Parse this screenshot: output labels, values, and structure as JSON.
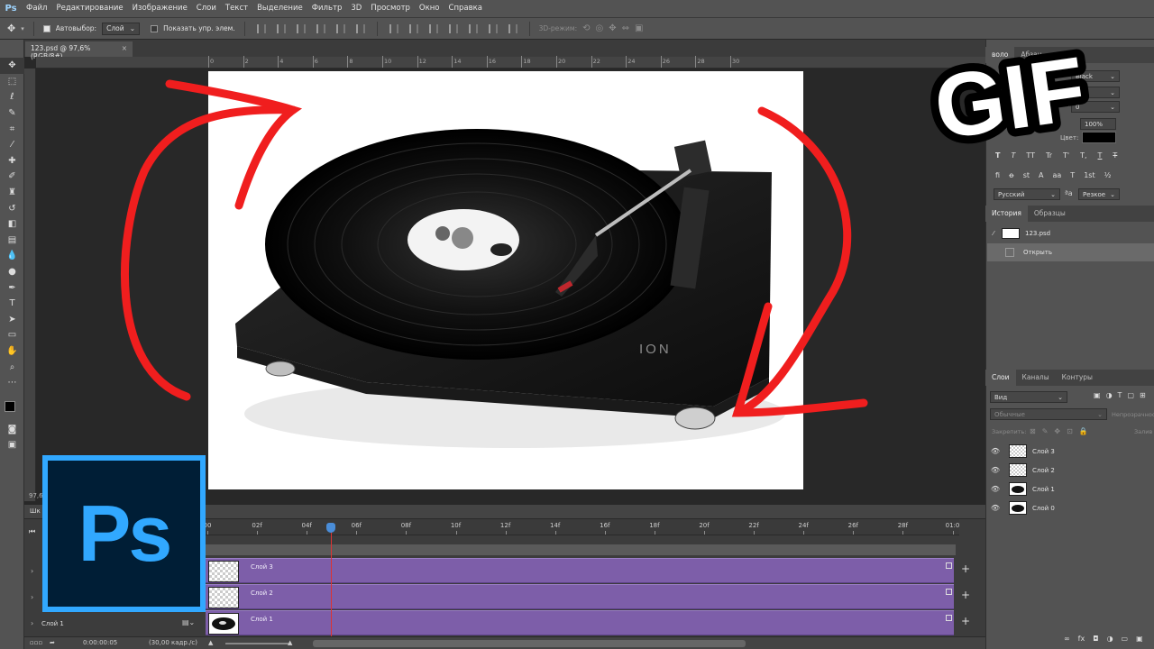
{
  "menubar": {
    "logo": "Ps",
    "items": [
      "Файл",
      "Редактирование",
      "Изображение",
      "Слои",
      "Текст",
      "Выделение",
      "Фильтр",
      "3D",
      "Просмотр",
      "Окно",
      "Справка"
    ]
  },
  "options": {
    "autoselect_label": "Автовыбор:",
    "autoselect_value": "Слой",
    "show_controls_label": "Показать упр. элем.",
    "mode_3d_label": "3D-режим:"
  },
  "document": {
    "tab_title": "123.psd @ 97,6% (RGB/8#)",
    "zoom_status": "97,6",
    "ruler_top_labels": [
      "0",
      "2",
      "4",
      "6",
      "8",
      "10",
      "12",
      "14",
      "16",
      "18",
      "20",
      "22",
      "24",
      "26",
      "28",
      "30"
    ]
  },
  "canvas": {
    "brand": "ION"
  },
  "overlay": {
    "ps_logo": "Ps",
    "gif_text": "GIF"
  },
  "timeline": {
    "panel_title": "Шк",
    "time_labels": [
      "00",
      "02f",
      "04f",
      "06f",
      "08f",
      "10f",
      "12f",
      "14f",
      "16f",
      "18f",
      "20f",
      "22f",
      "24f",
      "26f",
      "28f",
      "01:0"
    ],
    "tracks": [
      {
        "label": "Слой 3"
      },
      {
        "label": "Слой 2"
      },
      {
        "label": "Слой 1"
      }
    ],
    "left_layer_label": "Слой 1",
    "current_time": "0:00:00:05",
    "fps": "(30,00 кадр./с)"
  },
  "character_panel": {
    "tab_partial": "воло",
    "tab_paragraph": "Абзац",
    "font_color_label": "Цвет:",
    "font_style": "Black",
    "tracking_value": "0",
    "scale_value": "100%",
    "language": "Русский",
    "antialias": "Резкое",
    "typestyle_buttons": [
      "T",
      "T",
      "TT",
      "Tr",
      "T'",
      "T,",
      "T",
      "T"
    ],
    "opentype_buttons": [
      "fi",
      "ꝋ",
      "st",
      "A",
      "aa",
      "T",
      "1st",
      "½"
    ]
  },
  "history_panel": {
    "tabs": [
      "История",
      "Образцы"
    ],
    "snapshot_label": "123.psd",
    "items": [
      "Открыть"
    ]
  },
  "layers_panel": {
    "tabs": [
      "Слои",
      "Каналы",
      "Контуры"
    ],
    "filter_label": "Вид",
    "blend_mode": "Обычные",
    "opacity_label": "Непрозрачнос",
    "lock_label": "Закрепить:",
    "fill_label": "Залив",
    "layers": [
      {
        "name": "Слой 3"
      },
      {
        "name": "Слой 2"
      },
      {
        "name": "Слой 1"
      },
      {
        "name": "Слой 0"
      }
    ]
  }
}
